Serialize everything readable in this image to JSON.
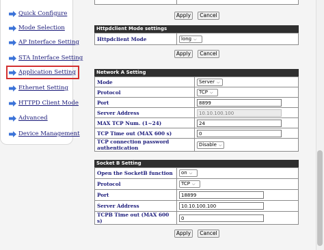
{
  "sidebar": {
    "items": [
      {
        "label": "Quick Configure"
      },
      {
        "label": "Mode Selection"
      },
      {
        "label": "AP Interface Setting"
      },
      {
        "label": "STA Interface Setting"
      },
      {
        "label": "Application Setting"
      },
      {
        "label": "Ethernet Setting"
      },
      {
        "label": "HTTPD Client Mode"
      },
      {
        "label": "Advanced"
      },
      {
        "label": "Device Management"
      }
    ],
    "active": "Application Setting"
  },
  "top_buttons": {
    "apply": "Apply",
    "cancel": "Cancel"
  },
  "httpclient": {
    "title": "Httpdclient Mode settings",
    "mode_label": "Httpdclient Mode",
    "mode_value": "long",
    "apply": "Apply",
    "cancel": "Cancel"
  },
  "network_a": {
    "title": "Network A Setting",
    "mode_label": "Mode",
    "mode_value": "Server",
    "protocol_label": "Protocol",
    "protocol_value": "TCP",
    "port_label": "Port",
    "port_value": "8899",
    "server_label": "Server Address",
    "server_value": "10.10.100.100",
    "max_tcp_label": "MAX TCP Num. (1~24)",
    "max_tcp_value": "24",
    "timeout_label": "TCP Time out (MAX 600 s)",
    "timeout_value": "0",
    "auth_label": "TCP connection password authentication",
    "auth_value": "Disable"
  },
  "socket_b": {
    "title": "Socket B Setting",
    "open_label": "Open the SocketB function",
    "open_value": "on",
    "protocol_label": "Protocol",
    "protocol_value": "TCP",
    "port_label": "Port",
    "port_value": "18899",
    "server_label": "Server Address",
    "server_value": "10.10.100.100",
    "timeout_label": "TCPB Time out (MAX 600 s)",
    "timeout_value": "0"
  },
  "bottom_buttons": {
    "apply": "Apply",
    "cancel": "Cancel"
  },
  "colors": {
    "accent_link": "#1a1a7a",
    "header_bg": "#2f2f2f",
    "arrow": "#3b73d8",
    "highlight": "#d32f2f"
  }
}
